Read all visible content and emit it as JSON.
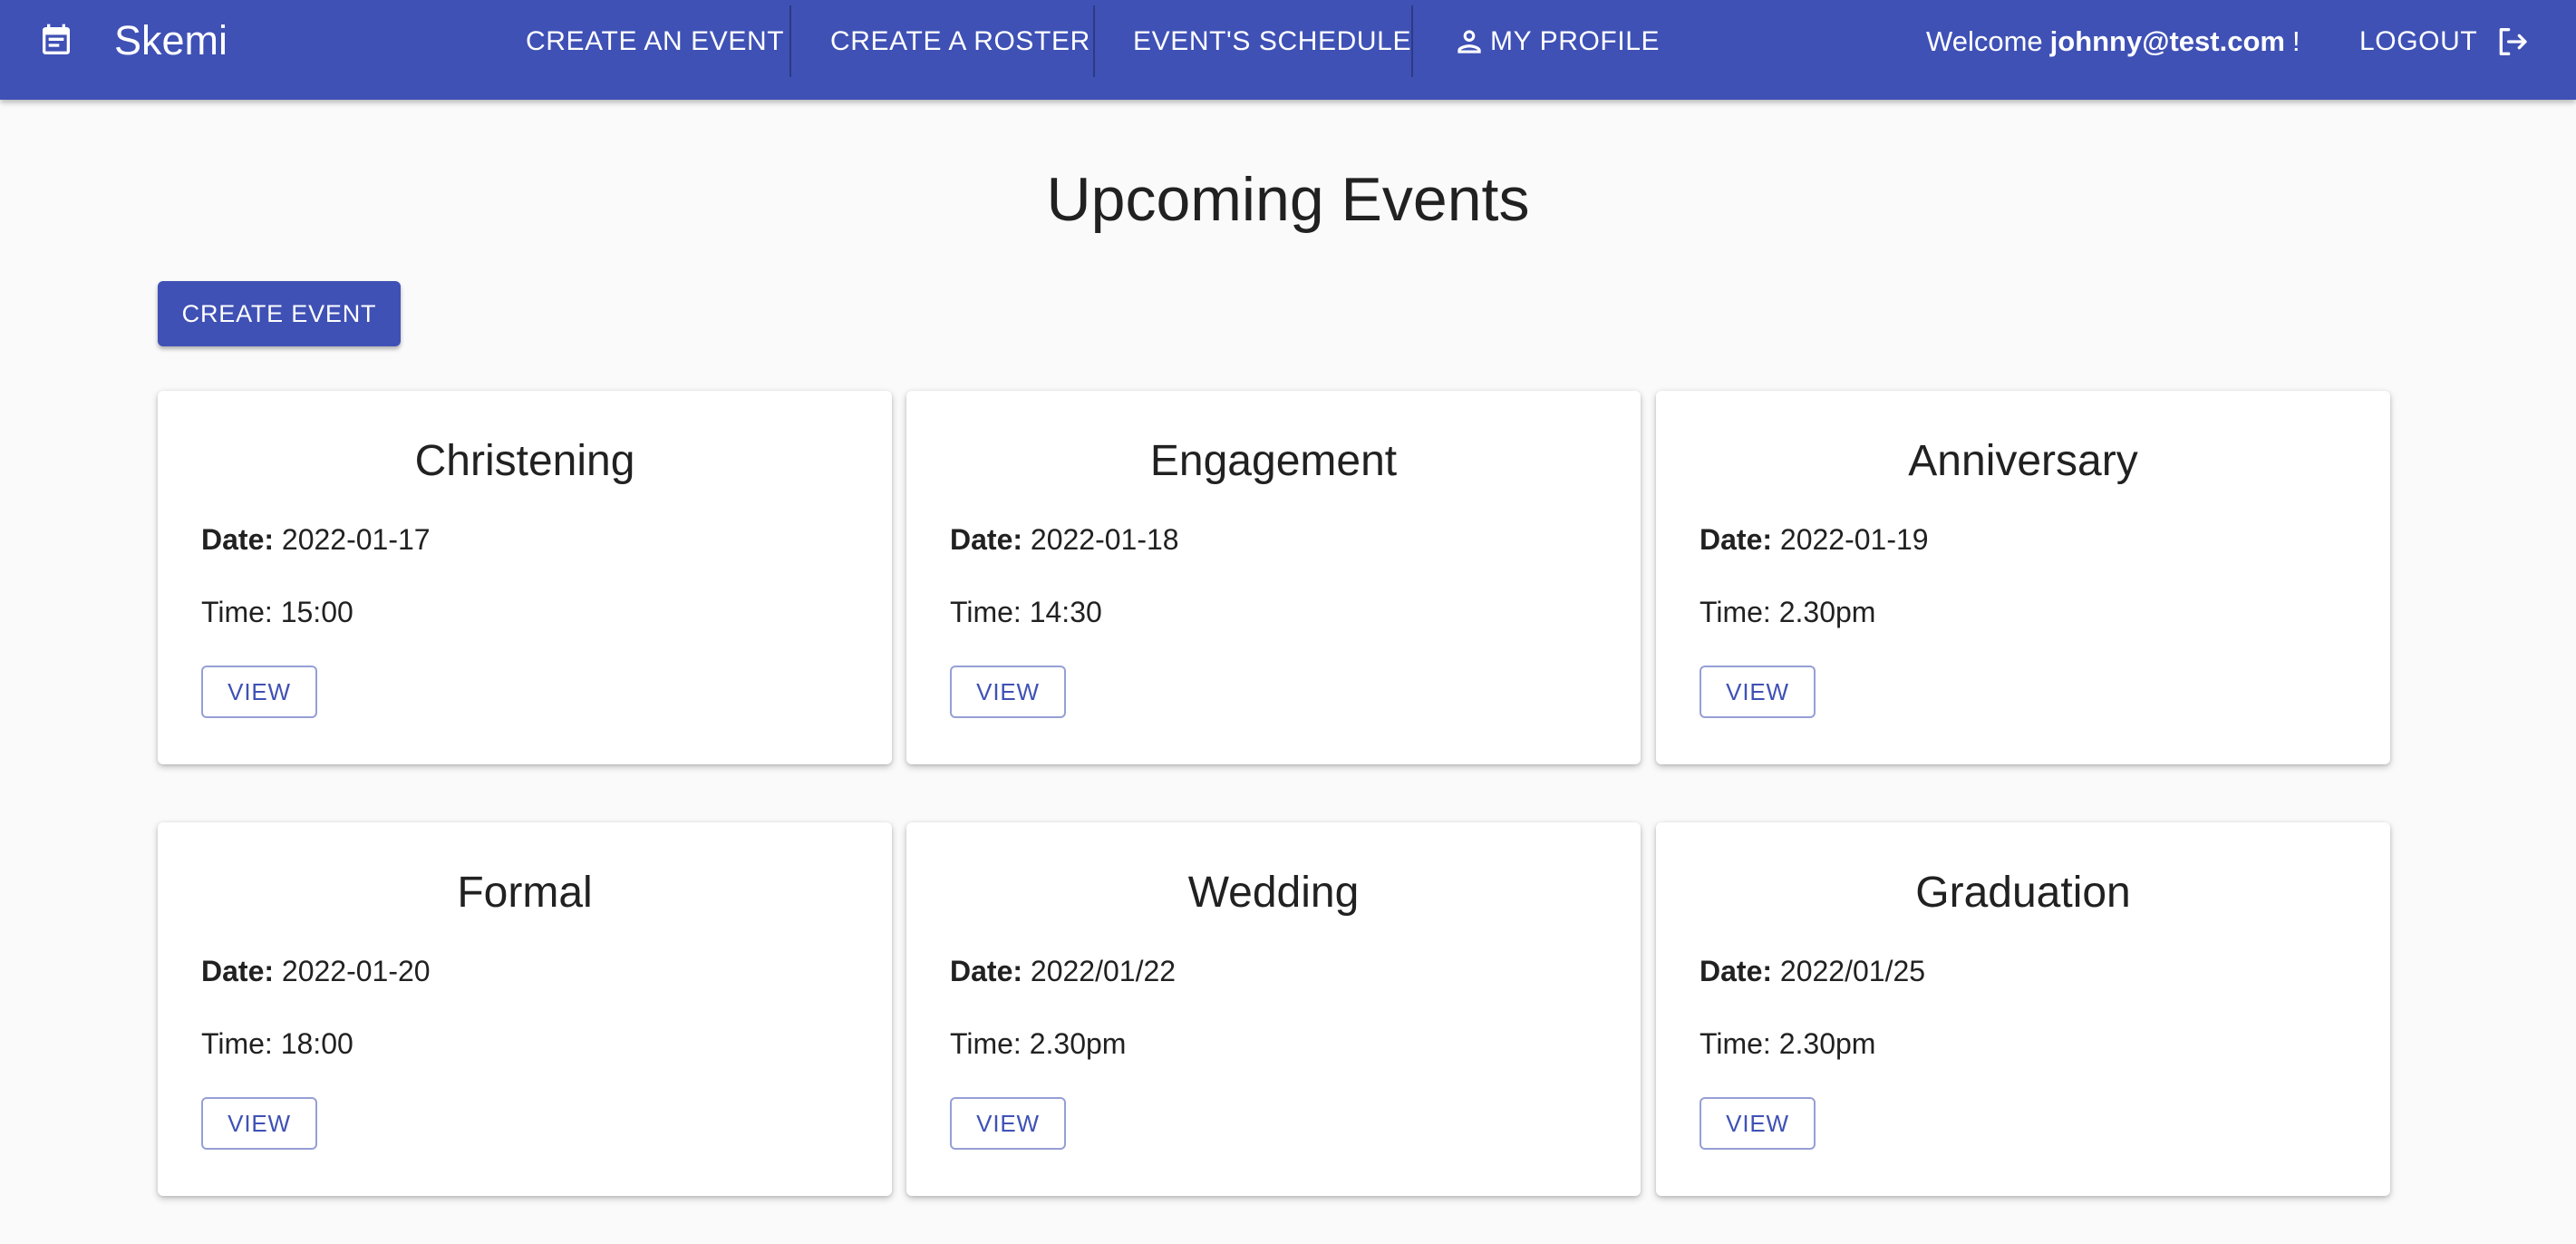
{
  "app": {
    "name": "Skemi",
    "brand_icon": "calendar-icon",
    "accent_color": "#3f51b5"
  },
  "nav": {
    "items": [
      {
        "label": "CREATE AN EVENT"
      },
      {
        "label": "CREATE A ROSTER"
      },
      {
        "label": "EVENT'S SCHEDULE"
      },
      {
        "label": "MY PROFILE",
        "icon": "person-icon"
      }
    ],
    "welcome_prefix": "Welcome",
    "user_email": "johnny@test.com",
    "welcome_suffix": "!",
    "logout_label": "LOGOUT",
    "logout_icon": "logout-icon"
  },
  "main": {
    "title": "Upcoming Events",
    "create_button_label": "CREATE EVENT",
    "date_label": "Date:",
    "time_label": "Time:",
    "view_label": "VIEW",
    "events": [
      {
        "name": "Christening",
        "date": "2022-01-17",
        "time": "15:00"
      },
      {
        "name": "Engagement",
        "date": "2022-01-18",
        "time": "14:30"
      },
      {
        "name": "Anniversary",
        "date": "2022-01-19",
        "time": "2.30pm"
      },
      {
        "name": "Formal",
        "date": "2022-01-20",
        "time": "18:00"
      },
      {
        "name": "Wedding",
        "date": "2022/01/22",
        "time": "2.30pm"
      },
      {
        "name": "Graduation",
        "date": "2022/01/25",
        "time": "2.30pm"
      }
    ]
  }
}
